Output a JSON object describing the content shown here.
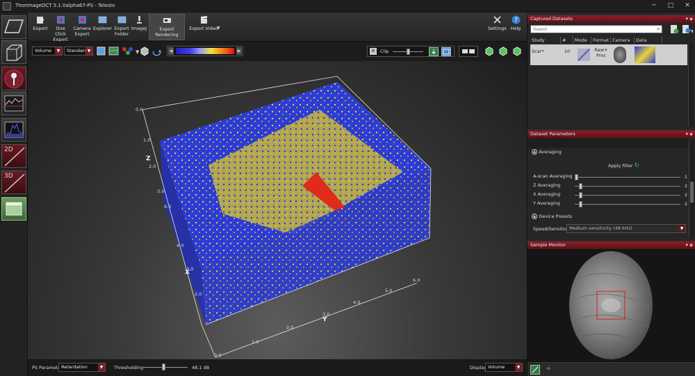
{
  "window": {
    "title": "ThorImageOCT 5.1.0alpha67-PS - Telesto",
    "minimize": "─",
    "maximize": "□",
    "close": "✕"
  },
  "left_sidebar": {
    "buttons": [
      "",
      "",
      "",
      "",
      "",
      "2D",
      "3D",
      ""
    ]
  },
  "toolbar": {
    "export": "Export",
    "one_click_export": [
      "One Click",
      "Export"
    ],
    "camera_export": [
      "Camera",
      "Export"
    ],
    "explorer": "Explorer",
    "export_folder": [
      "Export",
      "Folder"
    ],
    "imagej": "ImageJ",
    "export_rendering": "Export Rendering",
    "export_video": "Export Video",
    "settings": "Settings",
    "help": "Help"
  },
  "toolbar2": {
    "mode_select": "Volume",
    "style_select": "Standard",
    "clip_label": "Clip"
  },
  "axes": {
    "z_label": "Z",
    "x_label": "X",
    "y_label": "Y",
    "z_ticks": [
      "0.0",
      "1.0",
      "2.0",
      "3.0",
      "4.0",
      "5.0"
    ],
    "x_ticks_mid": "3.0",
    "y_ticks": [
      "0.0",
      "1.0",
      "2.0",
      "3.0",
      "4.0",
      "5.0",
      "6.0"
    ],
    "z_tick_extra": [
      "6.0",
      "4.0",
      "2.0"
    ]
  },
  "bottombar": {
    "ps_parameter_label": "PS Parameter",
    "ps_parameter_value": "Retardation",
    "thresholding_label": "Thresholding",
    "thresholding_value": "48.1 dB",
    "display_label": "Display",
    "display_value": "Volume"
  },
  "captured_datasets": {
    "title": "Captured Datasets",
    "pin": "▾ ◈",
    "search_placeholder": "Search",
    "columns": [
      "Study",
      "#",
      "Mode",
      "Format",
      "Camera",
      "Data"
    ],
    "row": {
      "study": "Scar*",
      "number": "10",
      "format": [
        "Raw+",
        "Proc"
      ]
    }
  },
  "dataset_parameters": {
    "title": "Dataset Parameters",
    "pin": "▾ ◈",
    "averaging_header": "Averaging",
    "apply_filter": "Apply filter",
    "sliders": [
      {
        "label": "A-scan Averaging",
        "value": "1",
        "level": 0.0
      },
      {
        "label": "Z Averaging",
        "value": "2",
        "level": 0.04
      },
      {
        "label": "X Averaging",
        "value": "2",
        "level": 0.04
      },
      {
        "label": "Y Averaging",
        "value": "2",
        "level": 0.04
      }
    ],
    "device_presets_header": "Device Presets",
    "speed_label": "Speed/Sensitivity",
    "speed_value": "Medium sensitivity (48 kHz)"
  },
  "sample_monitor": {
    "title": "Sample Monitor",
    "pin": "▾ ◈"
  },
  "colors": {
    "accent_red": "#8c1f28",
    "volume_blue": "#2c3bd6",
    "volume_yellow": "#e7d23a",
    "volume_red": "#e02a1a"
  }
}
